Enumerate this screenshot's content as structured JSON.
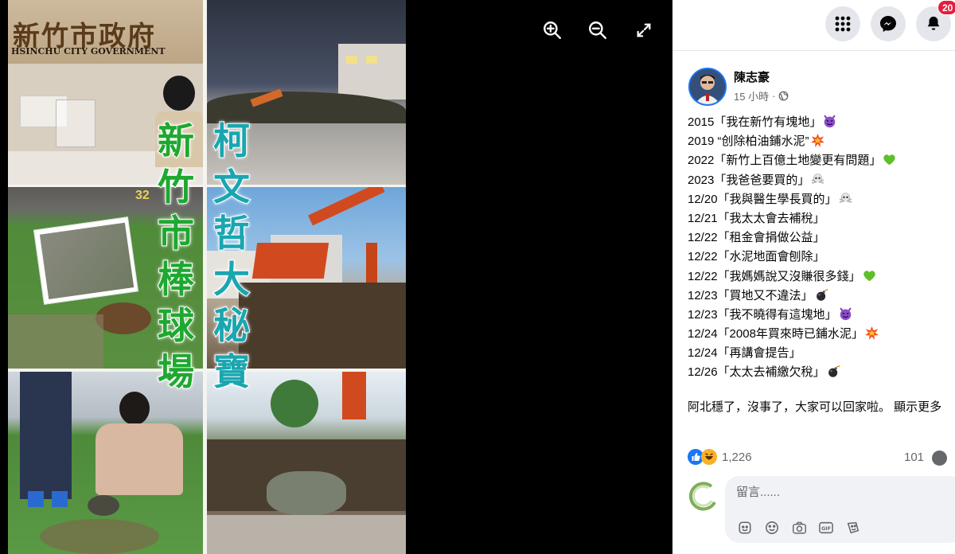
{
  "viewer": {
    "zoom_in_icon": "zoom-in-icon",
    "zoom_out_icon": "zoom-out-icon",
    "fullscreen_icon": "expand-icon",
    "photo": {
      "sign_cn": "新竹市政府",
      "sign_en": "HSINCHU CITY GOVERNMENT",
      "left_caption": [
        "新",
        "竹",
        "市",
        "棒",
        "球",
        "場"
      ],
      "right_caption": [
        "柯",
        "文",
        "哲",
        "大",
        "秘",
        "寶"
      ],
      "scoreboard": "32",
      "left_caption_color": "#1fa830",
      "right_caption_color": "#1aa6b0"
    }
  },
  "topbar": {
    "menu_icon": "grid-menu-icon",
    "messenger_icon": "messenger-icon",
    "notifications_icon": "bell-icon",
    "notification_badge": "20"
  },
  "post": {
    "author": "陳志豪",
    "time": "15 小時",
    "separator": "·",
    "privacy_icon": "globe-icon",
    "lines": [
      {
        "text": "2015「我在新竹有塊地」",
        "emoji": "devil"
      },
      {
        "text": "2019 “创除柏油鋪水泥”",
        "emoji": "explosion"
      },
      {
        "text": "2022「新竹上百億土地變更有問題」",
        "emoji": "green-heart"
      },
      {
        "text": "2023「我爸爸要買的」",
        "emoji": "skull"
      },
      {
        "text": "12/20「我與醫生學長買的」",
        "emoji": "skull"
      },
      {
        "text": "12/21「我太太會去補稅」",
        "emoji": ""
      },
      {
        "text": "12/22「租金會捐做公益」",
        "emoji": ""
      },
      {
        "text": "12/22「水泥地面會刨除」",
        "emoji": ""
      },
      {
        "text": "12/22「我媽媽說又沒賺很多錢」",
        "emoji": "green-heart"
      },
      {
        "text": "12/23「買地又不違法」",
        "emoji": "bomb"
      },
      {
        "text": "12/23「我不曉得有這塊地」",
        "emoji": "devil"
      },
      {
        "text": "12/24「2008年買來時已鋪水泥」",
        "emoji": "explosion"
      },
      {
        "text": "12/24「再講會提告」",
        "emoji": ""
      },
      {
        "text": "12/26「太太去補繳欠稅」",
        "emoji": "bomb"
      }
    ],
    "closing": "阿北穩了，沒事了，大家可以回家啦。 顯示更多"
  },
  "reactions": {
    "like_icon": "like-reaction-icon",
    "haha_icon": "haha-reaction-icon",
    "count": "1,226",
    "comments": "101",
    "comment_icon": "comment-bubble-icon"
  },
  "comment": {
    "placeholder": "留言......",
    "tools": [
      "sticker-icon",
      "emoji-icon",
      "camera-icon",
      "gif-icon",
      "avatar-sticker-icon"
    ]
  }
}
